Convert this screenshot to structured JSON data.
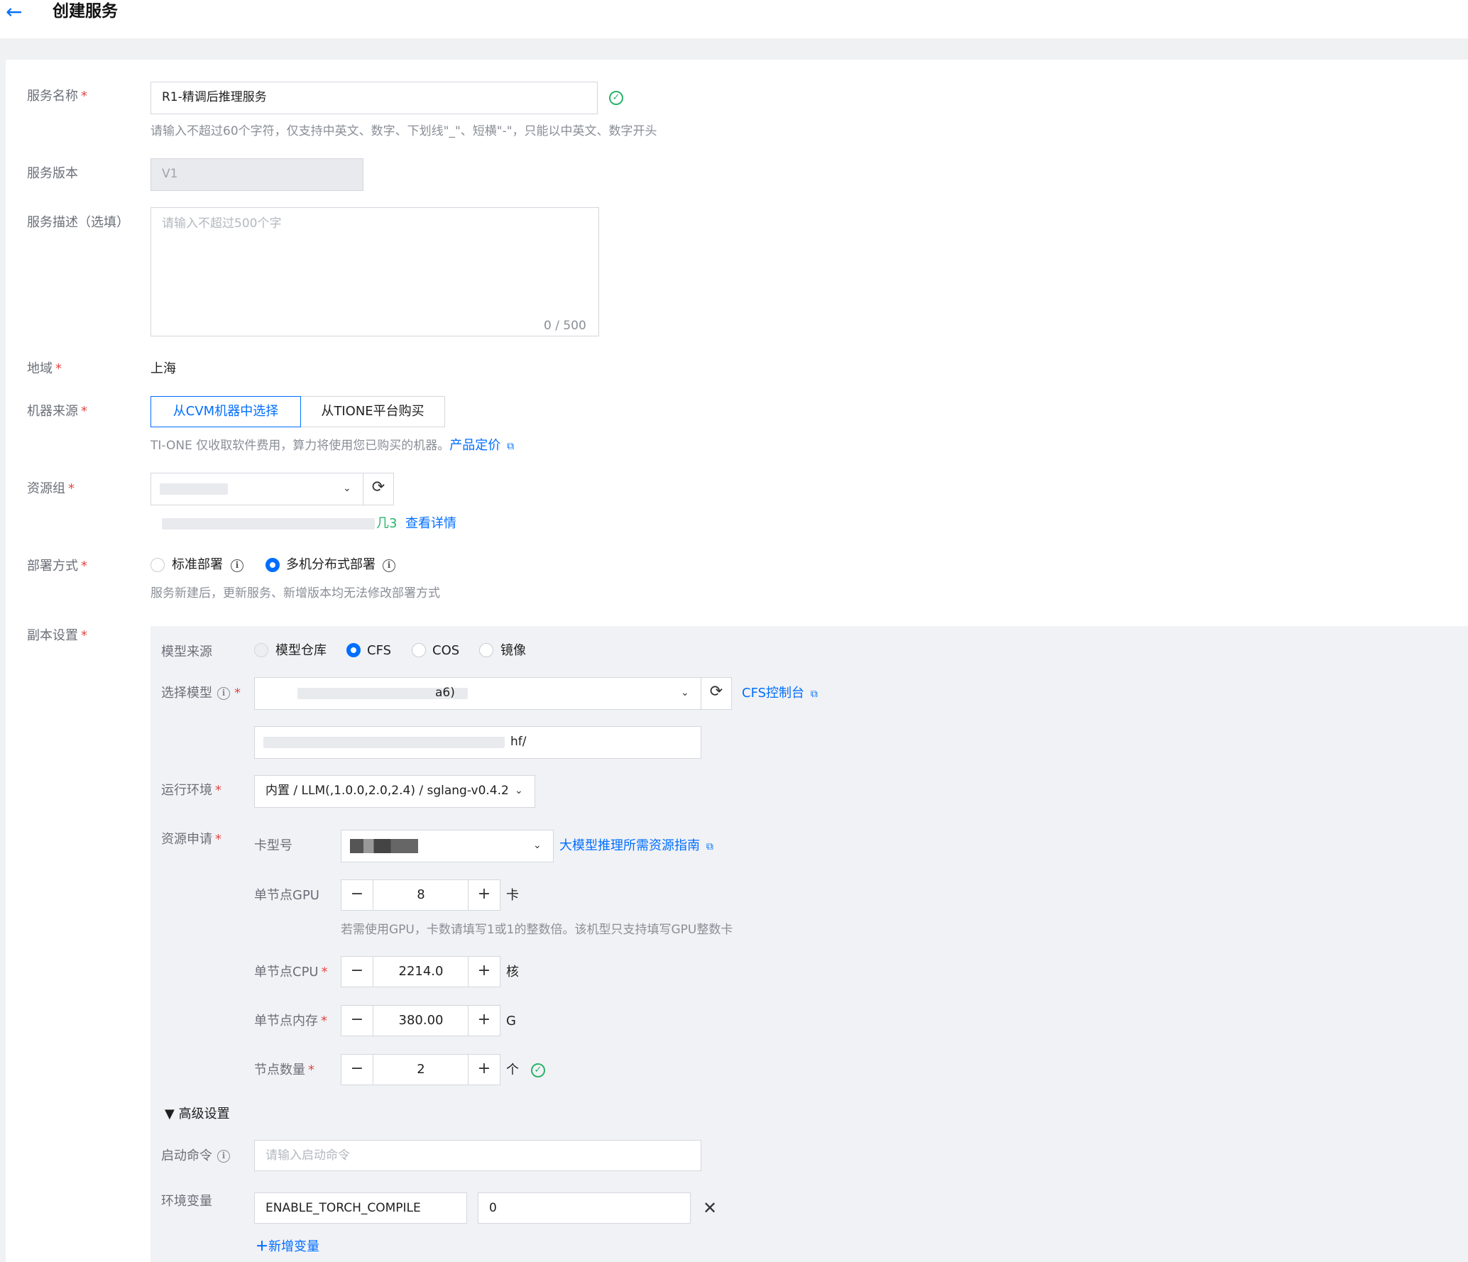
{
  "header": {
    "title": "创建服务"
  },
  "form": {
    "service_name": {
      "label": "服务名称",
      "value": "R1-精调后推理服务",
      "hint": "请输入不超过60个字符，仅支持中英文、数字、下划线\"_\"、短横\"-\"，只能以中英文、数字开头"
    },
    "service_version": {
      "label": "服务版本",
      "value": "V1"
    },
    "service_desc": {
      "label": "服务描述（选填）",
      "placeholder": "请输入不超过500个字",
      "counter": "0 / 500"
    },
    "region": {
      "label": "地域",
      "value": "上海"
    },
    "machine_source": {
      "label": "机器来源",
      "options": [
        "从CVM机器中选择",
        "从TIONE平台购买"
      ],
      "selected": "从CVM机器中选择",
      "hint": "TI-ONE 仅收取软件费用，算力将使用您已购买的机器。",
      "hint_link": "产品定价"
    },
    "resource_group": {
      "label": "资源组",
      "detail_suffix": "几3",
      "detail_link": "查看详情"
    },
    "deploy_mode": {
      "label": "部署方式",
      "options": [
        "标准部署",
        "多机分布式部署"
      ],
      "selected": "多机分布式部署",
      "hint": "服务新建后，更新服务、新增版本均无法修改部署方式"
    },
    "replica": {
      "label": "副本设置",
      "model_source": {
        "label": "模型来源",
        "options": [
          "模型仓库",
          "CFS",
          "COS",
          "镜像"
        ],
        "selected": "CFS"
      },
      "select_model": {
        "label": "选择模型",
        "value": "a6)",
        "path": "hf/",
        "link": "CFS控制台"
      },
      "runtime": {
        "label": "运行环境",
        "value": "内置 / LLM(,1.0.0,2.0,2.4) / sglang-v0.4.2"
      },
      "resource": {
        "label": "资源申请",
        "card_label": "卡型号",
        "guide_link": "大模型推理所需资源指南",
        "gpu": {
          "label": "单节点GPU",
          "value": "8",
          "unit": "卡",
          "hint": "若需使用GPU，卡数请填写1或1的整数倍。该机型只支持填写GPU整数卡"
        },
        "cpu": {
          "label": "单节点CPU",
          "value": "2214.0",
          "unit": "核"
        },
        "memory": {
          "label": "单节点内存",
          "value": "380.00",
          "unit": "G"
        },
        "nodes": {
          "label": "节点数量",
          "value": "2",
          "unit": "个"
        }
      }
    },
    "advanced": {
      "toggle": "▼ 高级设置",
      "start_cmd": {
        "label": "启动命令",
        "placeholder": "请输入启动命令"
      },
      "env": {
        "label": "环境变量",
        "key": "ENABLE_TORCH_COMPILE",
        "value": "0",
        "add": "新增变量"
      }
    }
  },
  "colors": {
    "accent": "#006eff",
    "required": "#e54545",
    "success": "#29b36a",
    "panel_bg": "#f1f2f5"
  }
}
